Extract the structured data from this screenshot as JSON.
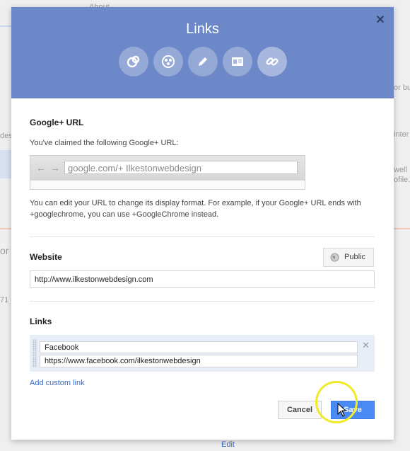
{
  "background": {
    "top_label": "About",
    "left_fragment_1": "des",
    "left_fragment_2": "or",
    "left_fragment_3": "71",
    "right_fragment_1": "or bu",
    "right_fragment_2": "inter",
    "right_fragment_3": "well",
    "right_fragment_4": "ofile.",
    "bottom_link": "Edit"
  },
  "dialog": {
    "title": "Links",
    "close_icon": "close-icon",
    "header_icons": [
      "link-circle-icon",
      "people-circle-icon",
      "pencil-icon",
      "card-icon",
      "chain-link-icon"
    ],
    "active_header_icon": "chain-link-icon",
    "header_color": "#6d88c8"
  },
  "google_url": {
    "title": "Google+ URL",
    "claimed_text": "You've claimed the following Google+ URL:",
    "url_value": "google.com/+ Ilkestonwebdesign",
    "help_text_line1": "You can edit your URL to change its display format. For example, if your Google+ URL ends with",
    "help_text_line2": "+googlechrome, you can use +GoogleChrome instead."
  },
  "website": {
    "title": "Website",
    "visibility_label": "Public",
    "url_value": "http://www.ilkestonwebdesign.com"
  },
  "links": {
    "title": "Links",
    "items": [
      {
        "label": "Facebook",
        "url": "https://www.facebook.com/ilkestonwebdesign"
      }
    ],
    "add_label": "Add custom link"
  },
  "actions": {
    "cancel_label": "Cancel",
    "save_label": "Save",
    "save_color": "#4a8af4"
  }
}
